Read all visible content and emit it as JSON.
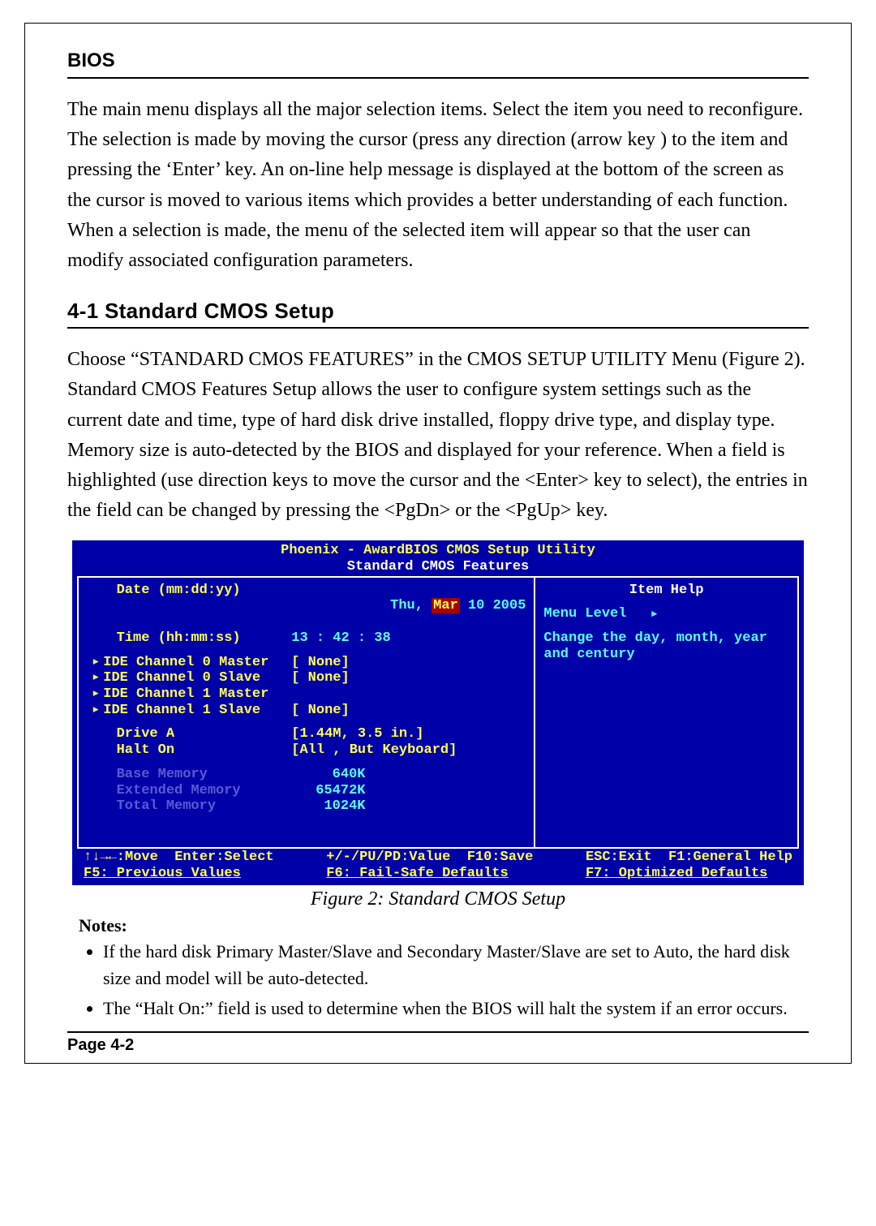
{
  "header": {
    "title": "BIOS"
  },
  "intro": "The main menu displays all the major selection items. Select the item you need to reconfigure.  The selection is made by moving the cursor (press any direction (arrow key ) to the item and pressing the ‘Enter’ key. An on-line help message is displayed at the bottom of the screen as the cursor is moved to various items which provides a better understanding of each function. When a selection is made, the menu of the selected item will appear so that the user can modify associated configuration parameters.",
  "section": {
    "title": "4-1 Standard CMOS Setup",
    "body": "Choose “STANDARD CMOS FEATURES” in the CMOS SETUP UTILITY Menu (Figure 2). Standard CMOS Features Setup allows the user  to configure system settings such as the current date and time, type of hard disk drive installed, floppy drive type, and display type. Memory size is auto-detected by the BIOS and displayed for your reference. When a field is highlighted (use direction keys to move the cursor and the <Enter> key to select), the entries in the field can be changed by pressing the <PgDn> or the <PgUp> key."
  },
  "bios": {
    "title1": "Phoenix - AwardBIOS CMOS Setup Utility",
    "title2": "Standard CMOS Features",
    "date_label": "Date (mm:dd:yy)",
    "date_val_pre": "Thu, ",
    "date_val_sel": "Mar",
    "date_val_post": " 10 2005",
    "time_label": "Time (hh:mm:ss)",
    "time_val": "13 : 42 : 38",
    "ide": [
      {
        "label": "IDE Channel 0 Master",
        "val": "[ None]"
      },
      {
        "label": "IDE Channel 0 Slave",
        "val": "[ None]"
      },
      {
        "label": "IDE Channel 1 Master",
        "val": ""
      },
      {
        "label": "IDE Channel 1 Slave",
        "val": "[ None]"
      }
    ],
    "driveA_label": "Drive A",
    "driveA_val": "[1.44M, 3.5 in.]",
    "halt_label": "Halt On",
    "halt_val": "[All , But Keyboard]",
    "mem": [
      {
        "label": "Base Memory",
        "val": "  640K"
      },
      {
        "label": "Extended Memory",
        "val": "65472K"
      },
      {
        "label": "Total Memory",
        "val": " 1024K"
      }
    ],
    "help_title": "Item Help",
    "menu_level": "Menu Level",
    "help_text": "Change the day, month, year and century",
    "nav": {
      "c1a": "↑↓→←:Move  Enter:Select",
      "c2a": "+/-/PU/PD:Value  F10:Save",
      "c3a": "ESC:Exit  F1:General Help",
      "c1b": "F5: Previous Values",
      "c2b": "F6: Fail-Safe Defaults",
      "c3b": "F7: Optimized Defaults"
    }
  },
  "figure_caption": "Figure 2:   Standard CMOS Setup",
  "notes_heading": "Notes:",
  "notes": [
    "If the hard disk Primary Master/Slave and Secondary Master/Slave are set to Auto, the hard disk size and model will be auto-detected.",
    "The “Halt On:” field is used to determine when the BIOS will halt the system if an error occurs."
  ],
  "page_number": "Page 4-2"
}
